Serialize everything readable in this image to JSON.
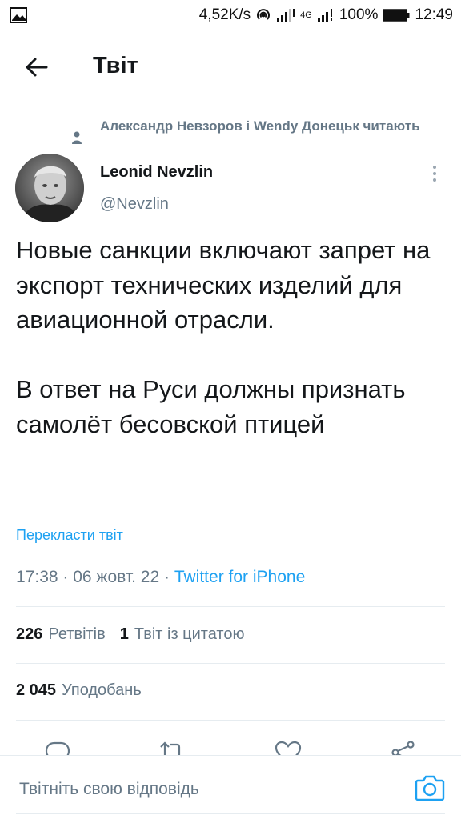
{
  "status_bar": {
    "speed": "4,52K/s",
    "network": "4G",
    "battery": "100%",
    "time": "12:49"
  },
  "header": {
    "title": "Твіт"
  },
  "social_context": {
    "text": "Александр Невзоров і Wendy Донецьк читають"
  },
  "author": {
    "name": "Leonid Nevzlin",
    "handle": "@Nevzlin"
  },
  "tweet": {
    "text": "Новые санкции включают запрет на экспорт технических изделий для авиационной отрасли.\n\nВ ответ на Руси должны признать самолёт бесовской птицей",
    "translate_label": "Перекласти твіт",
    "time": "17:38",
    "date": "06 жовт. 22",
    "source": "Twitter for iPhone"
  },
  "stats": {
    "retweets_count": "226",
    "retweets_label": "Ретвітів",
    "quotes_count": "1",
    "quotes_label": "Твіт із цитатою",
    "likes_count": "2 045",
    "likes_label": "Уподобань"
  },
  "composer": {
    "placeholder": "Твітніть свою відповідь"
  },
  "colors": {
    "accent": "#1da1f2",
    "secondary_text": "#657786",
    "primary_text": "#14171a",
    "divider": "#e6ecf0"
  },
  "icons": {
    "back": "arrow-left-icon",
    "social": "person-icon",
    "more": "more-vertical-icon",
    "reply": "reply-icon",
    "retweet": "retweet-icon",
    "like": "heart-icon",
    "share": "share-icon",
    "camera": "camera-icon"
  }
}
